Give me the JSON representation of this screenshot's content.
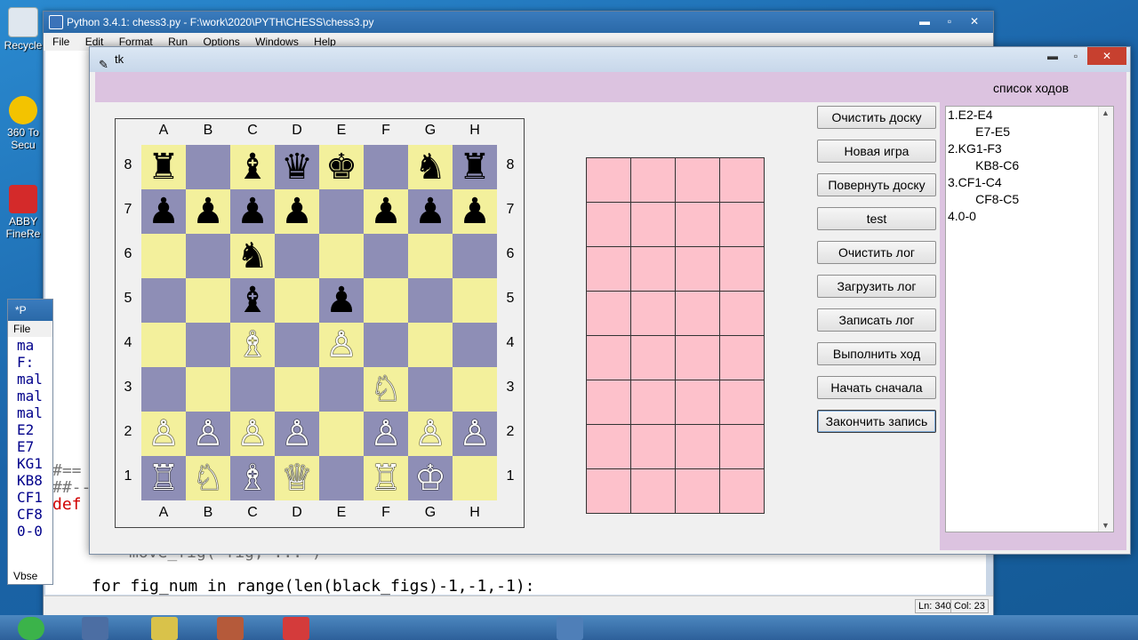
{
  "desktop": {
    "icons": [
      {
        "name": "recycle-bin",
        "label": "Recycle"
      },
      {
        "name": "360-security",
        "label": "360 To Secu"
      },
      {
        "name": "abbyy-finereader",
        "label": "ABBY FineRe"
      }
    ]
  },
  "idle": {
    "title": "Python 3.4.1: chess3.py - F:\\work\\2020\\PYTH\\CHESS\\chess3.py",
    "menu": [
      "File",
      "Edit",
      "Format",
      "Run",
      "Options",
      "Windows",
      "Help"
    ],
    "code_line": "for fig_num in range(len(black_figs)-1,-1,-1):",
    "code_hidden": "move_fig( fig,  ...  )",
    "side_lines": [
      "#==",
      "##--",
      "def"
    ],
    "status_ln": "Ln: 340",
    "status_col": "Col: 23"
  },
  "left_window": {
    "title": "*P",
    "menu": "File",
    "lines": [
      "ma",
      "F:",
      "mal",
      "mal",
      "mal",
      "E2",
      "E7",
      "KG1",
      "KB8",
      "CF1",
      "CF8",
      "0-0"
    ],
    "bottom": "Vbse"
  },
  "tk": {
    "title": "tk",
    "moves_label": "список ходов",
    "files": [
      "A",
      "B",
      "C",
      "D",
      "E",
      "F",
      "G",
      "H"
    ],
    "ranks": [
      "8",
      "7",
      "6",
      "5",
      "4",
      "3",
      "2",
      "1"
    ],
    "colors": {
      "light": "#f3f09c",
      "dark": "#8e8eb6",
      "pink": "#fdc1cb",
      "panel": "#dcc3e0"
    },
    "board": [
      [
        "♜",
        "",
        "♝",
        "♛",
        "♚",
        "",
        "♞",
        "♜"
      ],
      [
        "♟",
        "♟",
        "♟",
        "♟",
        "",
        "♟",
        "♟",
        "♟"
      ],
      [
        "",
        "",
        "♞",
        "",
        "",
        "",
        "",
        ""
      ],
      [
        "",
        "",
        "♝",
        "",
        "♟",
        "",
        "",
        ""
      ],
      [
        "",
        "",
        "♗",
        "",
        "♙",
        "",
        "",
        ""
      ],
      [
        "",
        "",
        "",
        "",
        "",
        "♘",
        "",
        ""
      ],
      [
        "♙",
        "♙",
        "♙",
        "♙",
        "",
        "♙",
        "♙",
        "♙"
      ],
      [
        "♖",
        "♘",
        "♗",
        "♕",
        "",
        "♖",
        "♔",
        ""
      ]
    ],
    "buttons": [
      "Очистить доску",
      "Новая игра",
      "Повернуть доску",
      "test",
      "Очистить лог",
      "Загрузить лог",
      "Записать лог",
      "Выполнить ход",
      "Начать сначала",
      "Закончить запись"
    ],
    "moves": [
      "1.E2-E4",
      "        E7-E5",
      "2.KG1-F3",
      "        KB8-C6",
      "3.CF1-C4",
      "        CF8-C5",
      "4.0-0"
    ]
  }
}
